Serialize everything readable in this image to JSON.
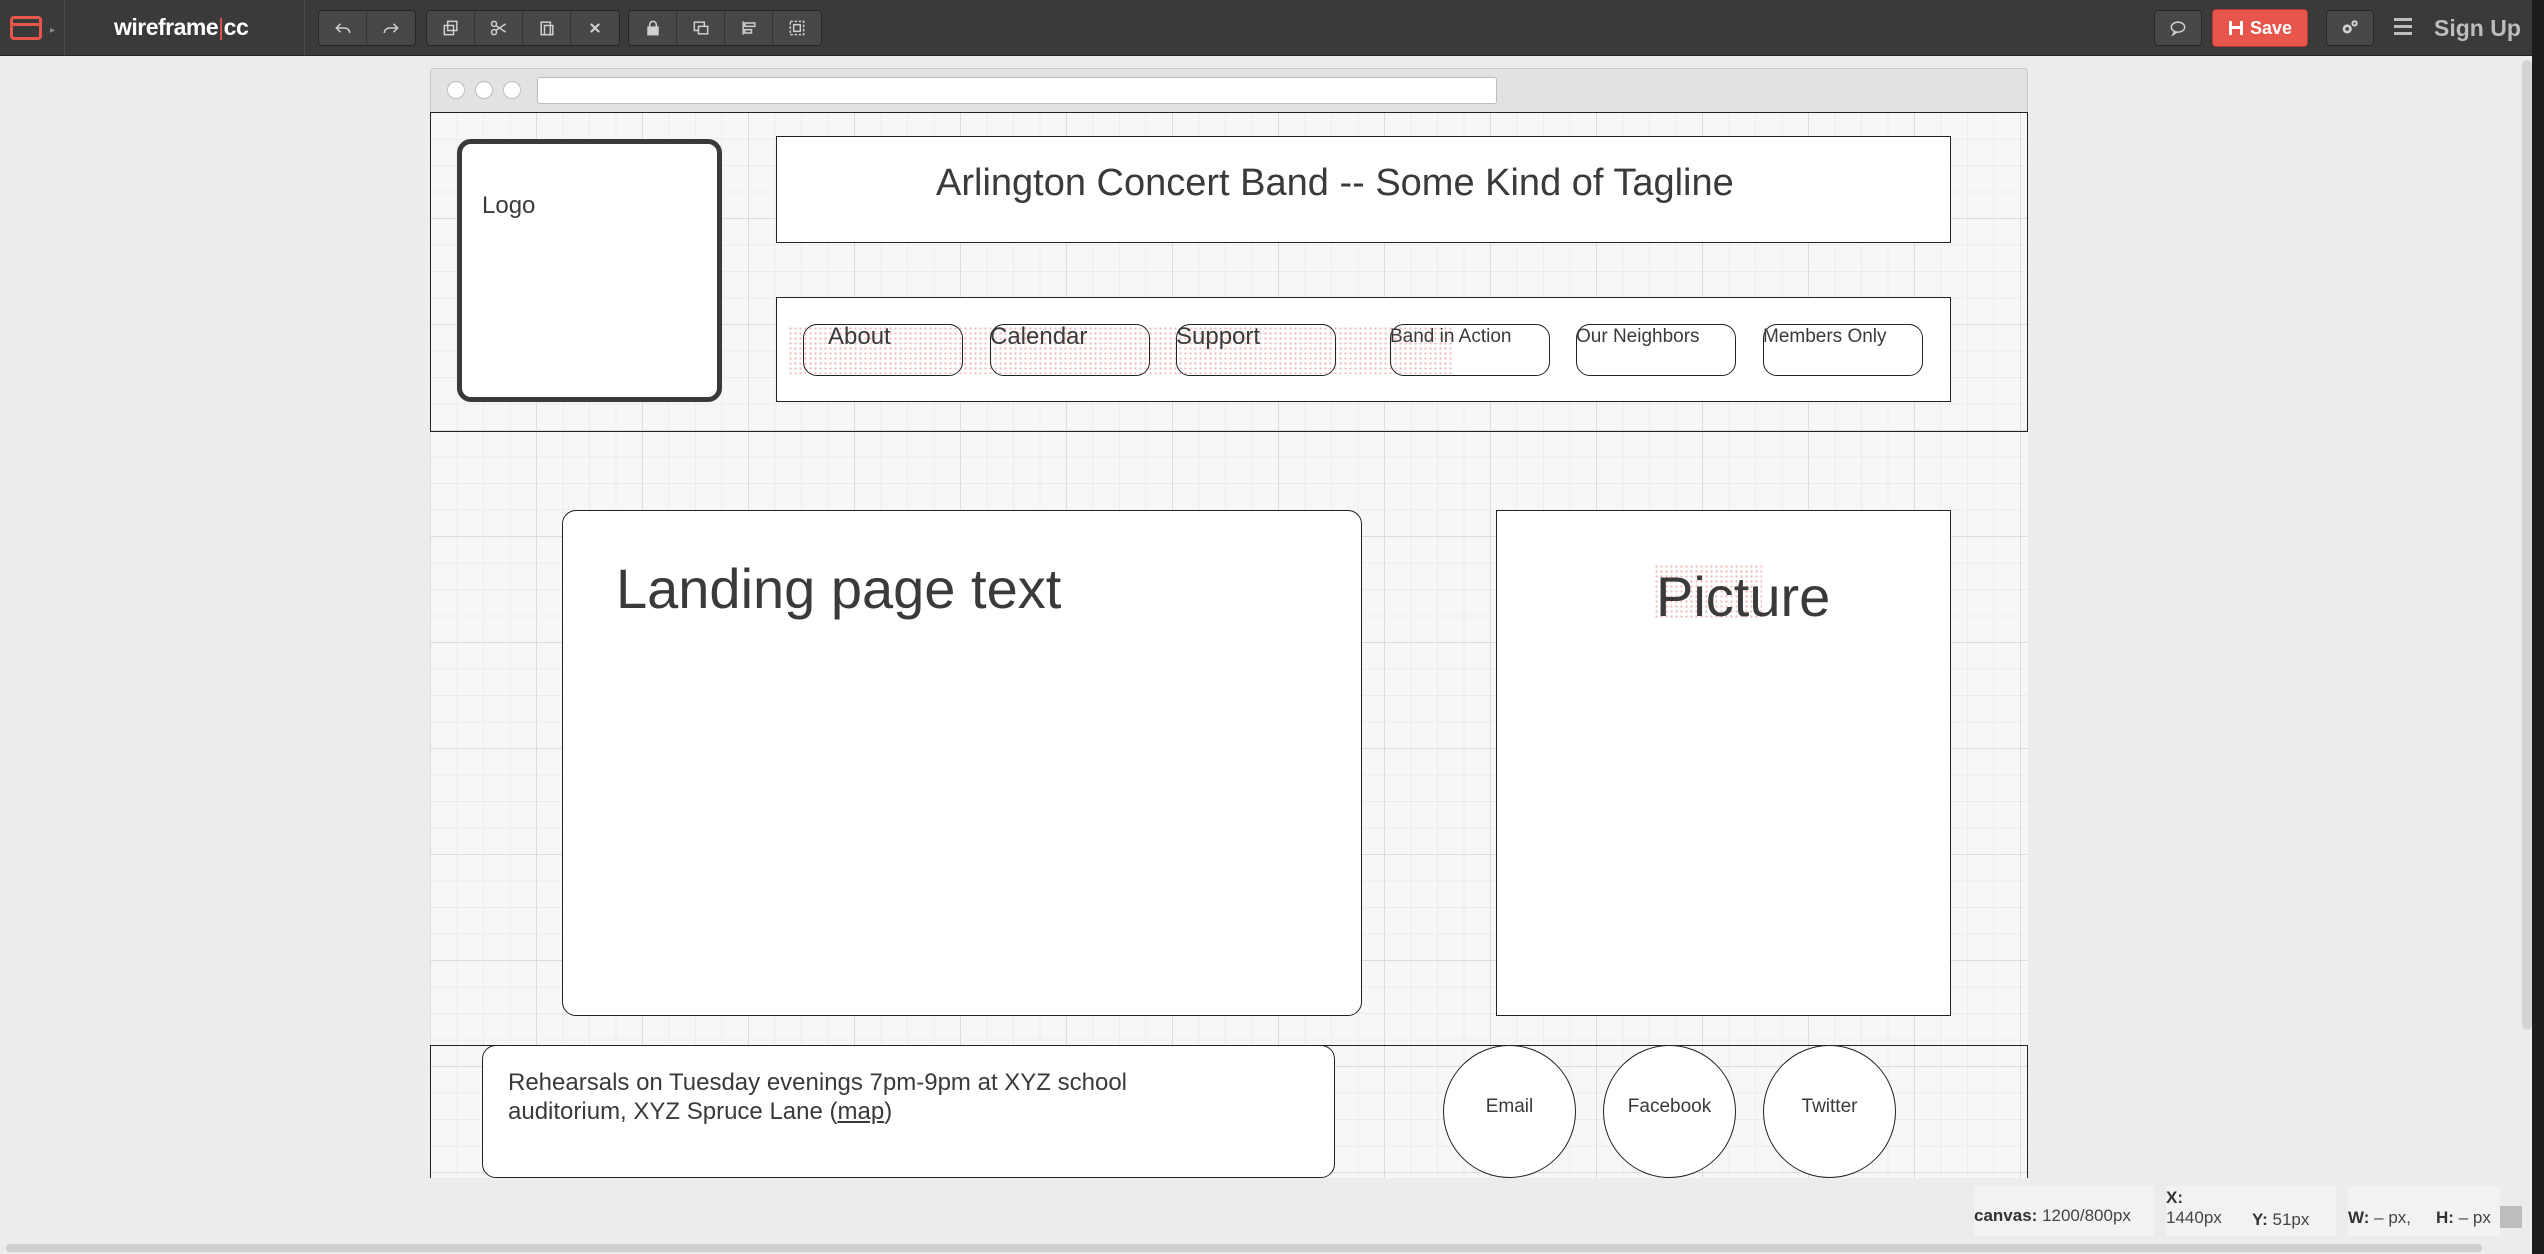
{
  "app": {
    "brand_part1": "wireframe",
    "brand_sep": "|",
    "brand_part2": "cc",
    "save_label": "Save",
    "signup_label": "Sign Up"
  },
  "wireframe": {
    "logo_label": "Logo",
    "tagline": "Arlington Concert Band -- Some Kind of Tagline",
    "nav_items": [
      {
        "label": "About"
      },
      {
        "label": "Calendar"
      },
      {
        "label": "Support"
      },
      {
        "label": "Band in Action"
      },
      {
        "label": "Our Neighbors"
      },
      {
        "label": "Members Only"
      }
    ],
    "landing_text": "Landing page text",
    "picture_text": "Picture",
    "footer": {
      "rehearsal_text": "Rehearsals on Tuesday evenings 7pm-9pm at XYZ school auditorium, XYZ Spruce Lane (",
      "map_link": "map",
      "rehearsal_close": ")",
      "social": [
        {
          "label": "Email"
        },
        {
          "label": "Facebook"
        },
        {
          "label": "Twitter"
        }
      ]
    }
  },
  "status": {
    "canvas_label": "canvas:",
    "canvas_value": "1200/800px",
    "x_label": "X:",
    "x_value": "1440px",
    "y_label": "Y:",
    "y_value": "51px",
    "w_label": "W:",
    "w_value": "– px,",
    "h_label": "H:",
    "h_value": "– px"
  },
  "colors": {
    "accent": "#e8554b",
    "toolbar_bg": "#3a3a3a"
  }
}
